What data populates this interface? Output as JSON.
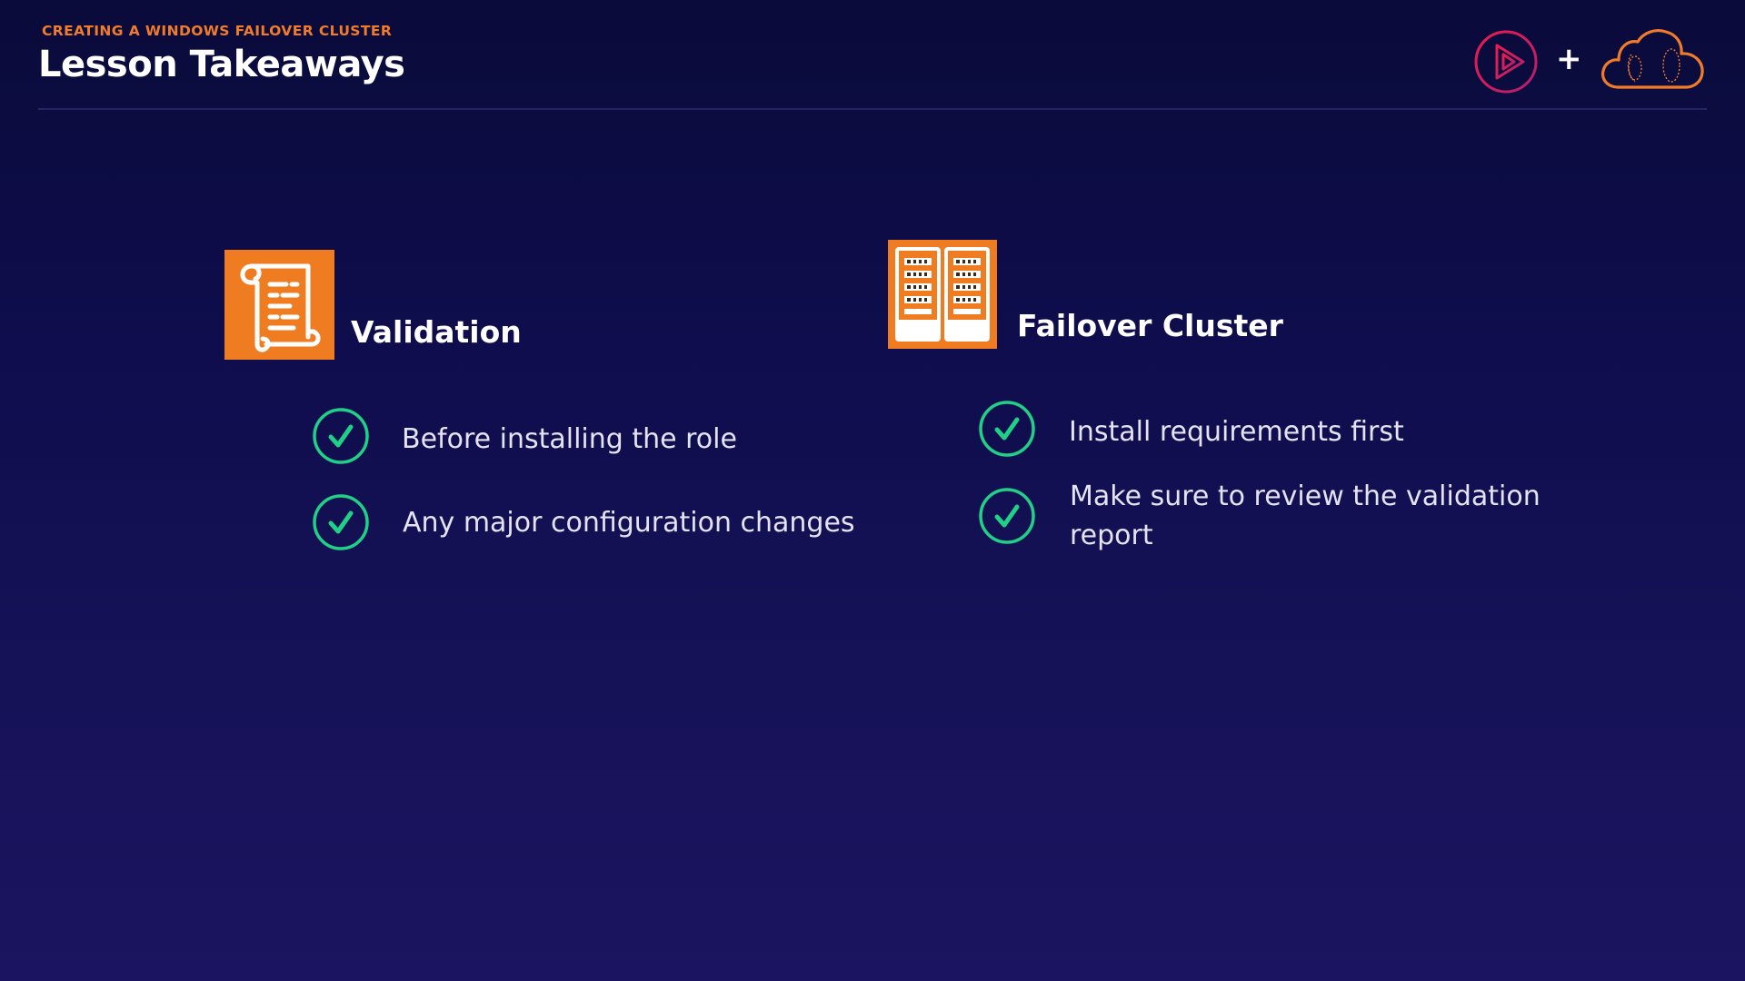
{
  "header": {
    "kicker": "CREATING A WINDOWS FAILOVER CLUSTER",
    "title": "Lesson Takeaways",
    "plus": "+"
  },
  "sections": [
    {
      "heading": "Validation",
      "icon": "scroll-document-icon",
      "items": [
        {
          "text": "Before installing the role"
        },
        {
          "text": "Any major configuration changes"
        }
      ]
    },
    {
      "heading": "Failover Cluster",
      "icon": "server-racks-icon",
      "items": [
        {
          "text": "Install requirements first"
        },
        {
          "text": "Make sure to review the validation report"
        }
      ]
    }
  ],
  "colors": {
    "accent_orange": "#f07c2b",
    "check_green": "#1fd086",
    "play_logo_gradient_start": "#e8194f",
    "play_logo_gradient_end": "#b81c6b",
    "background_top": "#0a0b3a",
    "background_bottom": "#1b1460"
  }
}
